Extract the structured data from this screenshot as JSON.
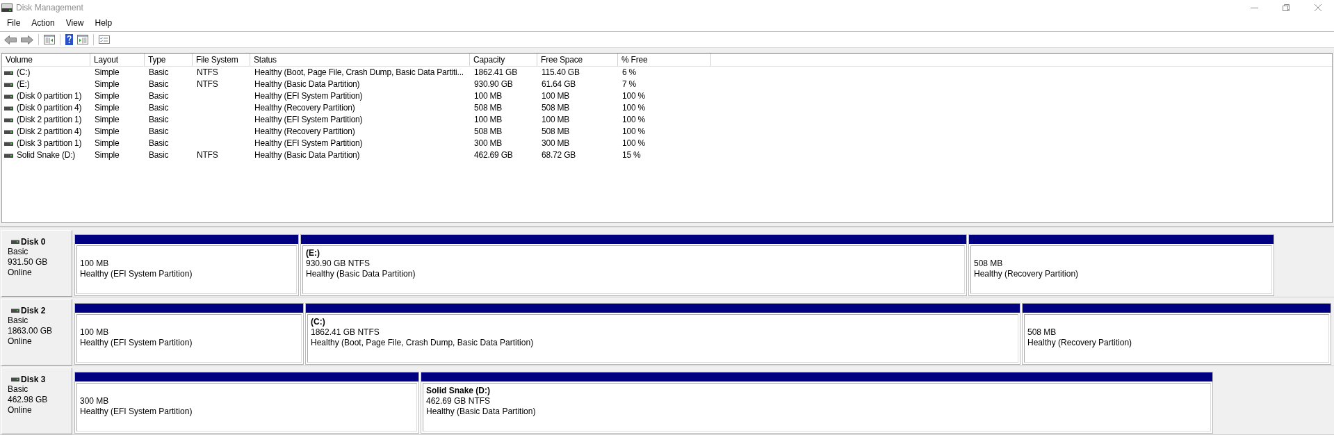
{
  "window": {
    "title": "Disk Management"
  },
  "menu": [
    "File",
    "Action",
    "View",
    "Help"
  ],
  "toolbar": {
    "back": {
      "disabled": true
    },
    "forward": {
      "disabled": true
    }
  },
  "volume_list": {
    "columns": [
      "Volume",
      "Layout",
      "Type",
      "File System",
      "Status",
      "Capacity",
      "Free Space",
      "% Free"
    ],
    "rows": [
      {
        "volume": "(C:)",
        "layout": "Simple",
        "type": "Basic",
        "file_system": "NTFS",
        "status": "Healthy (Boot, Page File, Crash Dump, Basic Data Partiti...",
        "capacity": "1862.41 GB",
        "free_space": "115.40 GB",
        "percent_free": "6 %"
      },
      {
        "volume": "(E:)",
        "layout": "Simple",
        "type": "Basic",
        "file_system": "NTFS",
        "status": "Healthy (Basic Data Partition)",
        "capacity": "930.90 GB",
        "free_space": "61.64 GB",
        "percent_free": "7 %"
      },
      {
        "volume": "(Disk 0 partition 1)",
        "layout": "Simple",
        "type": "Basic",
        "status": "Healthy (EFI System Partition)",
        "capacity": "100 MB",
        "free_space": "100 MB",
        "percent_free": "100 %"
      },
      {
        "volume": "(Disk 0 partition 4)",
        "layout": "Simple",
        "type": "Basic",
        "status": "Healthy (Recovery Partition)",
        "capacity": "508 MB",
        "free_space": "508 MB",
        "percent_free": "100 %"
      },
      {
        "volume": "(Disk 2 partition 1)",
        "layout": "Simple",
        "type": "Basic",
        "status": "Healthy (EFI System Partition)",
        "capacity": "100 MB",
        "free_space": "100 MB",
        "percent_free": "100 %"
      },
      {
        "volume": "(Disk 2 partition 4)",
        "layout": "Simple",
        "type": "Basic",
        "status": "Healthy (Recovery Partition)",
        "capacity": "508 MB",
        "free_space": "508 MB",
        "percent_free": "100 %"
      },
      {
        "volume": "(Disk 3 partition 1)",
        "layout": "Simple",
        "type": "Basic",
        "status": "Healthy (EFI System Partition)",
        "capacity": "300 MB",
        "free_space": "300 MB",
        "percent_free": "100 %"
      },
      {
        "volume": "Solid Snake (D:)",
        "layout": "Simple",
        "type": "Basic",
        "file_system": "NTFS",
        "status": "Healthy (Basic Data Partition)",
        "capacity": "462.69 GB",
        "free_space": "68.72 GB",
        "percent_free": "15 %"
      }
    ]
  },
  "disks": [
    {
      "name": "Disk 0",
      "type": "Basic",
      "size": "931.50 GB",
      "status": "Online",
      "partitions": [
        {
          "size": "100 MB",
          "status": "Healthy (EFI System Partition)"
        },
        {
          "label": "(E:)",
          "size": "930.90 GB NTFS",
          "status": "Healthy (Basic Data Partition)"
        },
        {
          "size": "508 MB",
          "status": "Healthy (Recovery Partition)"
        }
      ]
    },
    {
      "name": "Disk 2",
      "type": "Basic",
      "size": "1863.00 GB",
      "status": "Online",
      "partitions": [
        {
          "size": "100 MB",
          "status": "Healthy (EFI System Partition)"
        },
        {
          "label": "(C:)",
          "size": "1862.41 GB NTFS",
          "status": "Healthy (Boot, Page File, Crash Dump, Basic Data Partition)"
        },
        {
          "size": "508 MB",
          "status": "Healthy (Recovery Partition)"
        }
      ]
    },
    {
      "name": "Disk 3",
      "type": "Basic",
      "size": "462.98 GB",
      "status": "Online",
      "partitions": [
        {
          "size": "300 MB",
          "status": "Healthy (EFI System Partition)"
        },
        {
          "label": "Solid Snake (D:)",
          "size": "462.69 GB NTFS",
          "status": "Healthy (Basic Data Partition)"
        }
      ]
    }
  ]
}
